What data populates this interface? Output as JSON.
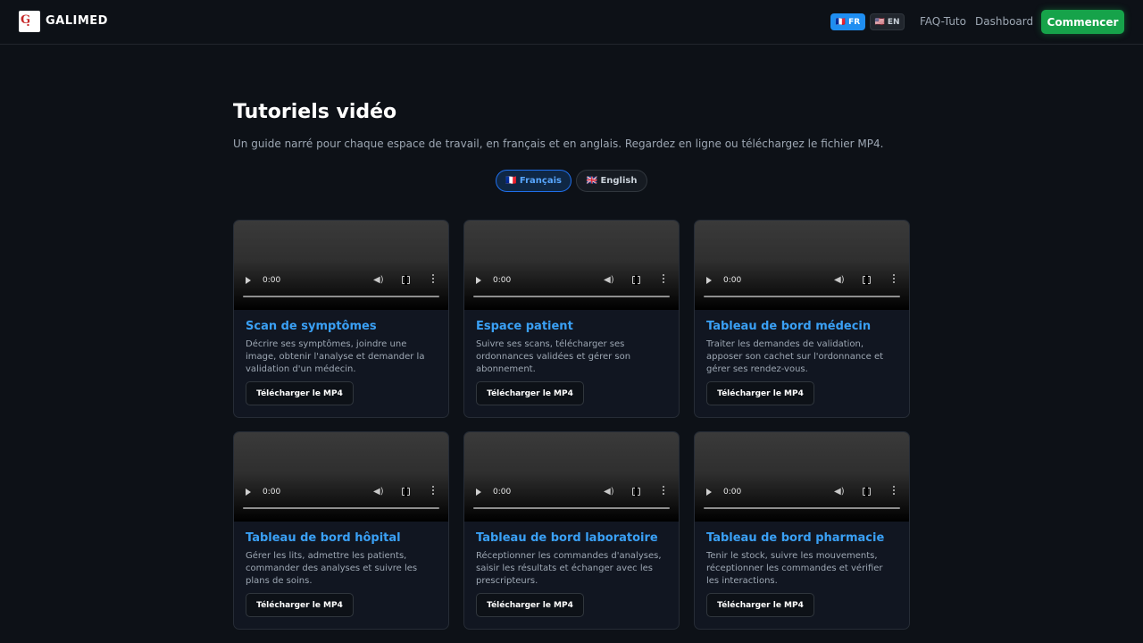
{
  "header": {
    "brand": "GALIMED",
    "logo_letter": "G",
    "lang_fr": "🇫🇷 FR",
    "lang_en": "🇺🇸 EN",
    "faq": "FAQ-Tuto",
    "dashboard": "Dashboard",
    "start": "Commencer"
  },
  "main": {
    "title": "Tutoriels vidéo",
    "subtitle": "Un guide narré pour chaque espace de travail, en français et en anglais. Regardez en ligne ou téléchargez le fichier MP4.",
    "tabs": [
      {
        "label": "🇫🇷 Français",
        "active": true
      },
      {
        "label": "🇬🇧 English",
        "active": false
      }
    ]
  },
  "cards": [
    {
      "title": "Scan de symptômes",
      "desc": "Décrire ses symptômes, joindre une image, obtenir l'analyse et demander la validation d'un médecin.",
      "time": "0:00",
      "button": "Télécharger le MP4"
    },
    {
      "title": "Espace patient",
      "desc": "Suivre ses scans, télécharger ses ordonnances validées et gérer son abonnement.",
      "time": "0:00",
      "button": "Télécharger le MP4"
    },
    {
      "title": "Tableau de bord médecin",
      "desc": "Traiter les demandes de validation, apposer son cachet sur l'ordonnance et gérer ses rendez-vous.",
      "time": "0:00",
      "button": "Télécharger le MP4"
    },
    {
      "title": "Tableau de bord hôpital",
      "desc": "Gérer les lits, admettre les patients, commander des analyses et suivre les plans de soins.",
      "time": "0:00",
      "button": "Télécharger le MP4"
    },
    {
      "title": "Tableau de bord laboratoire",
      "desc": "Réceptionner les commandes d'analyses, saisir les résultats et échanger avec les prescripteurs.",
      "time": "0:00",
      "button": "Télécharger le MP4"
    },
    {
      "title": "Tableau de bord pharmacie",
      "desc": "Tenir le stock, suivre les mouvements, réceptionner les commandes et vérifier les interactions.",
      "time": "0:00",
      "button": "Télécharger le MP4"
    }
  ],
  "colors": {
    "background": "#0d1117",
    "accent_blue": "#3aa0f5",
    "start_green": "#16a34a",
    "lang_active": "#1f8ef1"
  }
}
